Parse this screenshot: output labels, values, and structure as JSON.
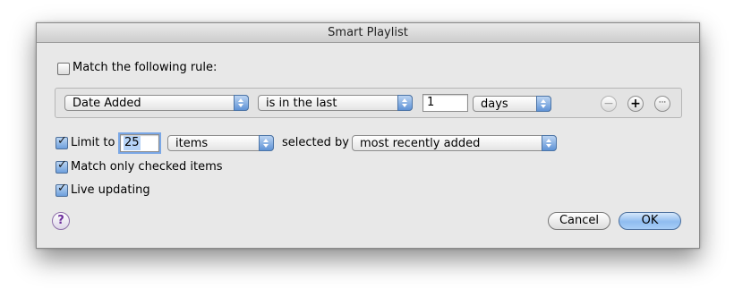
{
  "window": {
    "title": "Smart Playlist"
  },
  "match_rule": {
    "label": "Match the following rule:",
    "checked": false
  },
  "rule": {
    "field": "Date Added",
    "operator": "is in the last",
    "value": "1",
    "unit": "days",
    "remove_symbol": "−",
    "add_symbol": "+",
    "more_symbol": "···"
  },
  "limit": {
    "checked": true,
    "label": "Limit to",
    "value": "25",
    "unit": "items",
    "selected_by_label": "selected by",
    "selected_by": "most recently added"
  },
  "match_checked": {
    "label": "Match only checked items",
    "checked": true
  },
  "live_updating": {
    "label": "Live updating",
    "checked": true
  },
  "help": {
    "symbol": "?"
  },
  "buttons": {
    "cancel": "Cancel",
    "ok": "OK"
  },
  "colors": {
    "accent": "#6d9fdc",
    "help": "#6d2e9c"
  }
}
